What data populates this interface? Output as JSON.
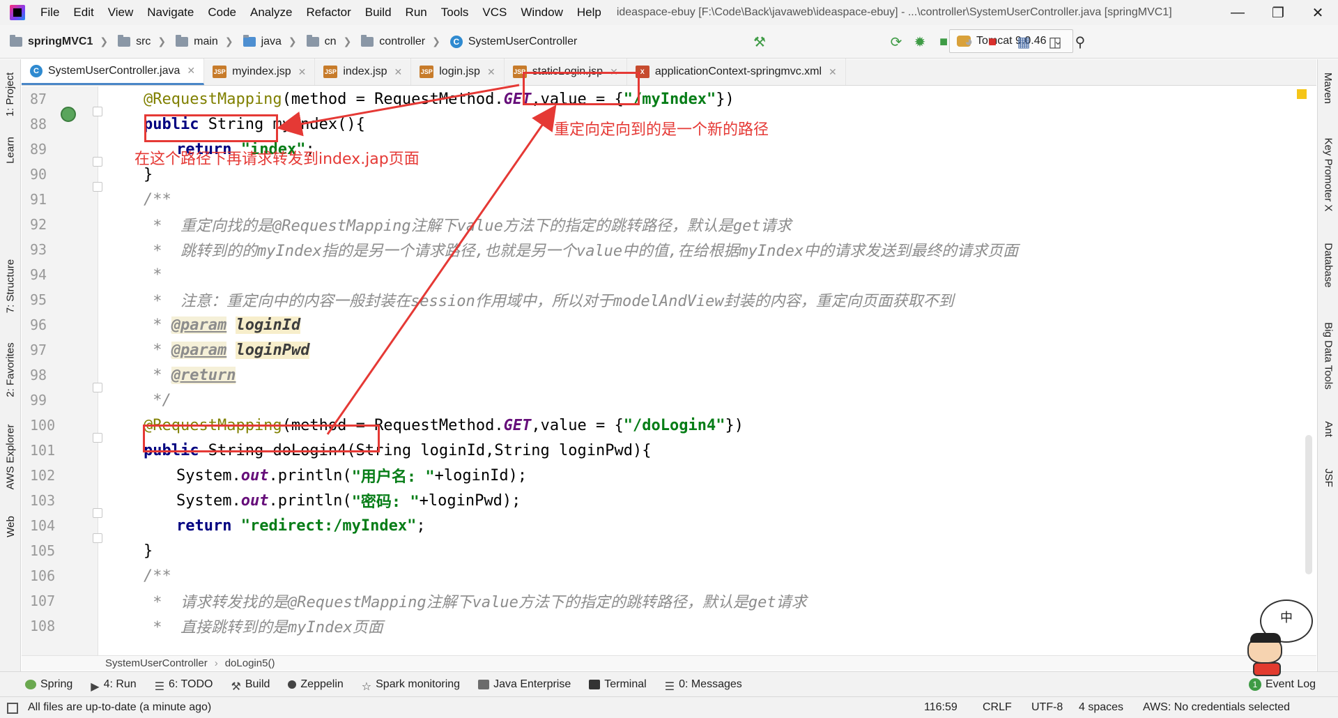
{
  "menubar": {
    "items": [
      "File",
      "Edit",
      "View",
      "Navigate",
      "Code",
      "Analyze",
      "Refactor",
      "Build",
      "Run",
      "Tools",
      "VCS",
      "Window",
      "Help"
    ],
    "window_title": "ideaspace-ebuy [F:\\Code\\Back\\javaweb\\ideaspace-ebuy] - ...\\controller\\SystemUserController.java [springMVC1]"
  },
  "navbar": {
    "module": "springMVC1",
    "crumbs": [
      "src",
      "main",
      "java",
      "cn",
      "controller",
      "SystemUserController"
    ],
    "run_config": "Tomcat 9.0.46"
  },
  "left_strip": {
    "tabs": [
      "1: Project",
      "Learn",
      "7: Structure",
      "2: Favorites",
      "AWS Explorer",
      "Web"
    ]
  },
  "right_strip": {
    "tabs": [
      "Maven",
      "Key Promoter X",
      "Database",
      "Big Data Tools",
      "Ant",
      "JSF"
    ]
  },
  "editor_tabs": [
    {
      "label": "SystemUserController.java",
      "type": "java",
      "icon_text": "C"
    },
    {
      "label": "myindex.jsp",
      "type": "jsp",
      "icon_text": "JSP"
    },
    {
      "label": "index.jsp",
      "type": "jsp",
      "icon_text": "JSP"
    },
    {
      "label": "login.jsp",
      "type": "jsp",
      "icon_text": "JSP"
    },
    {
      "label": "staticLogin.jsp",
      "type": "jsp",
      "icon_text": "JSP"
    },
    {
      "label": "applicationContext-springmvc.xml",
      "type": "xml",
      "icon_text": "X"
    }
  ],
  "editor": {
    "line_numbers": [
      "87",
      "88",
      "89",
      "90",
      "91",
      "92",
      "93",
      "94",
      "95",
      "96",
      "97",
      "98",
      "99",
      "100",
      "101",
      "102",
      "103",
      "104",
      "105",
      "106",
      "107",
      "108"
    ],
    "code": {
      "l87": {
        "ann": "@RequestMapping",
        "rest1": "(method = RequestMethod.",
        "field": "GET",
        "rest2": ",value = {",
        "str": "\"/myIndex\"",
        "rest3": "})"
      },
      "l88": {
        "kw": "public",
        "rest": " String myIndex(){"
      },
      "l89": {
        "kw": "return",
        "str": "\"index\"",
        "rest": ";"
      },
      "l90": {
        "rest": "}"
      },
      "l91": {
        "comment": "/**"
      },
      "l92": {
        "comment": " *  重定向找的是@RequestMapping注解下value方法下的指定的跳转路径，默认是get请求"
      },
      "l93": {
        "comment": " *  跳转到的的myIndex指的是另一个请求路径,也就是另一个value中的值,在给根据myIndex中的请求发送到最终的请求页面"
      },
      "l94": {
        "comment": " *"
      },
      "l95": {
        "comment": " *  注意：重定向中的内容一般封装在session作用域中，所以对于modelAndView封装的内容，重定向页面获取不到"
      },
      "l96": {
        "star": " * ",
        "tag": "@param",
        "param": "loginId"
      },
      "l97": {
        "star": " * ",
        "tag": "@param",
        "param": "loginPwd"
      },
      "l98": {
        "star": " * ",
        "tag": "@return"
      },
      "l99": {
        "comment": " */"
      },
      "l100": {
        "ann": "@RequestMapping",
        "rest1": "(method = RequestMethod.",
        "field": "GET",
        "rest2": ",value = {",
        "str": "\"/doLogin4\"",
        "rest3": "})"
      },
      "l101": {
        "kw": "public",
        "rest": " String doLogin4(String loginId,String loginPwd){"
      },
      "l102": {
        "pre": "System.",
        "field": "out",
        "mid": ".println(",
        "str": "\"用户名: \"",
        "rest": "+loginId);"
      },
      "l103": {
        "pre": "System.",
        "field": "out",
        "mid": ".println(",
        "str": "\"密码: \"",
        "rest": "+loginPwd);"
      },
      "l104": {
        "kw": "return",
        "str": "\"redirect:/myIndex\"",
        "rest": ";"
      },
      "l105": {
        "rest": "}"
      },
      "l106": {
        "comment": "/**"
      },
      "l107": {
        "comment": " *  请求转发找的是@RequestMapping注解下value方法下的指定的跳转路径，默认是get请求"
      },
      "l108": {
        "comment": " *  直接跳转到的是myIndex页面"
      }
    }
  },
  "annotations": {
    "note_redirect": "重定向定向到的是一个新的路径",
    "note_forward": "在这个路径下再请求转发到index.jap页面",
    "color": "#e53935"
  },
  "code_crumbs": {
    "class": "SystemUserController",
    "method": "doLogin5()"
  },
  "tool_windows": [
    {
      "label": "Spring"
    },
    {
      "label": "4: Run"
    },
    {
      "label": "6: TODO"
    },
    {
      "label": "Build"
    },
    {
      "label": "Zeppelin"
    },
    {
      "label": "Spark monitoring"
    },
    {
      "label": "Java Enterprise"
    },
    {
      "label": "Terminal"
    },
    {
      "label": "0: Messages"
    }
  ],
  "event_log": {
    "badge": "1",
    "label": "Event Log"
  },
  "statusbar": {
    "message": "All files are up-to-date (a minute ago)",
    "position": "116:59",
    "line_sep": "CRLF",
    "encoding": "UTF-8",
    "indent": "4 spaces",
    "aws": "AWS: No credentials selected"
  },
  "mascot": {
    "bubble_text": "中"
  }
}
